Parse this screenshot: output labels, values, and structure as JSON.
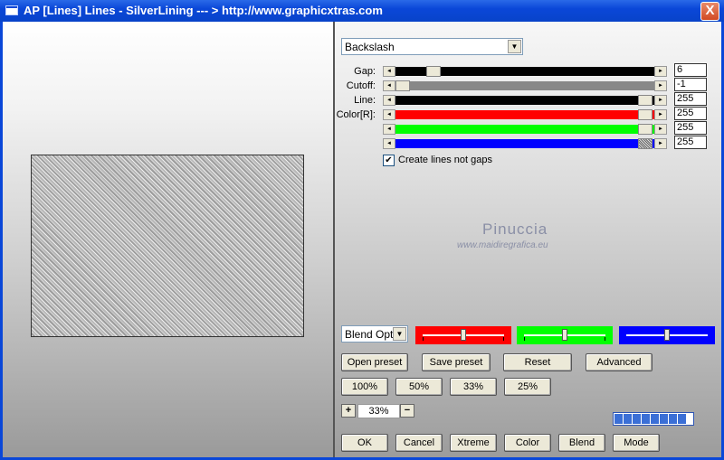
{
  "window": {
    "title": "AP [Lines]  Lines - SilverLining    --- > http://www.graphicxtras.com",
    "close_label": "X"
  },
  "preset_dropdown": {
    "value": "Backslash",
    "arrow": "▼"
  },
  "sliders": [
    {
      "label": "Gap:",
      "value": "6"
    },
    {
      "label": "Cutoff:",
      "value": "-1"
    },
    {
      "label": "Line:",
      "value": "255"
    },
    {
      "label": "Color[R]:",
      "value": "255"
    },
    {
      "label": "",
      "value": "255"
    },
    {
      "label": "",
      "value": "255"
    }
  ],
  "slider_arrows": {
    "left": "◄",
    "right": "►"
  },
  "checkbox": {
    "label": "Create lines not gaps",
    "checked": "✔"
  },
  "watermark": {
    "name": "Pinuccia",
    "url": "www.maidiregrafica.eu"
  },
  "blend_dropdown": {
    "value": "Blend Optio",
    "arrow": "▼"
  },
  "preset_buttons": {
    "open": "Open preset",
    "save": "Save preset",
    "reset": "Reset",
    "advanced": "Advanced"
  },
  "zoom_buttons": [
    "100%",
    "50%",
    "33%",
    "25%"
  ],
  "zoom": {
    "minus": "−",
    "plus": "+",
    "value": "33%"
  },
  "bottom_buttons": {
    "ok": "OK",
    "cancel": "Cancel",
    "xtreme": "Xtreme",
    "color": "Color",
    "blend": "Blend",
    "mode": "Mode"
  },
  "colors": {
    "red": "#ff0000",
    "green": "#00ff00",
    "blue": "#0000ff",
    "title_bar": "#0a47d8"
  }
}
